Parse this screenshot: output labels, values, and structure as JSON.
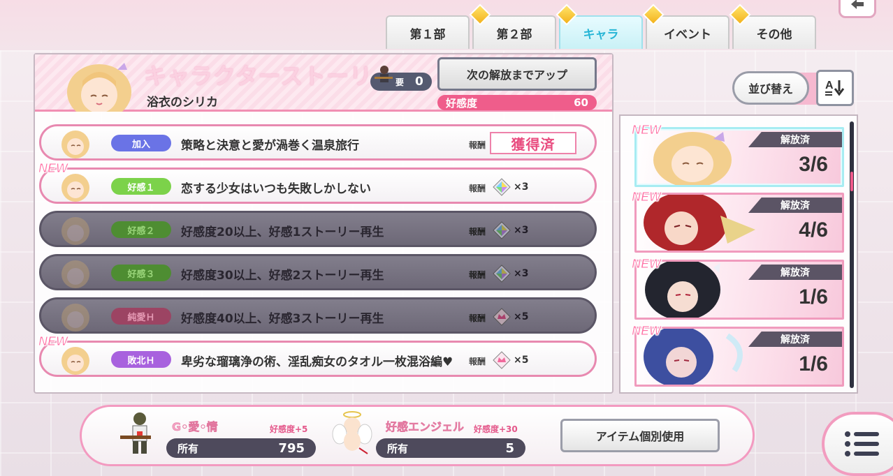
{
  "tabs": [
    {
      "label": "第１部",
      "badge": true
    },
    {
      "label": "第２部",
      "badge": true
    },
    {
      "label": "キャラ",
      "badge": true,
      "active": true
    },
    {
      "label": "イベント",
      "badge": true
    },
    {
      "label": "その他",
      "badge": true
    }
  ],
  "header": {
    "title": "キャラクターストーリー",
    "character_name": "浴衣のシリカ",
    "requirement_label": "要",
    "requirement_value": "0",
    "unlock_button": "次の解放までアップ",
    "affinity_label": "好感度",
    "affinity_value": "60"
  },
  "stories": [
    {
      "tag": "加入",
      "title": "策略と決意と愛が渦巻く温泉旅行",
      "reward_label": "報酬",
      "reward": "獲得済",
      "is_new": false,
      "locked": false
    },
    {
      "tag": "好感１",
      "title": "恋する少女はいつも失敗しかしない",
      "reward_label": "報酬",
      "reward": "×3",
      "is_new": true,
      "locked": false
    },
    {
      "tag": "好感２",
      "title": "好感度20以上、好感1ストーリー再生",
      "reward_label": "報酬",
      "reward": "×3",
      "is_new": false,
      "locked": true
    },
    {
      "tag": "好感３",
      "title": "好感度30以上、好感2ストーリー再生",
      "reward_label": "報酬",
      "reward": "×3",
      "is_new": false,
      "locked": true
    },
    {
      "tag": "純愛Ｈ",
      "title": "好感度40以上、好感3ストーリー再生",
      "reward_label": "報酬",
      "reward": "×5",
      "is_new": false,
      "locked": true
    },
    {
      "tag": "敗北Ｈ",
      "title": "卑劣な瑠璃浄の術、淫乱痴女のタオル一枚混浴編♥",
      "reward_label": "報酬",
      "reward": "×5",
      "is_new": true,
      "locked": false
    }
  ],
  "new_label": "NEW",
  "sort": {
    "label": "並び替え"
  },
  "characters": [
    {
      "status": "解放済",
      "count": "3/6",
      "is_new": true
    },
    {
      "status": "解放済",
      "count": "4/6",
      "is_new": true
    },
    {
      "status": "解放済",
      "count": "1/6",
      "is_new": true
    },
    {
      "status": "解放済",
      "count": "1/6",
      "is_new": true
    }
  ],
  "items": [
    {
      "name": "G◦愛◦情",
      "bonus": "好感度+5",
      "own_label": "所有",
      "own_value": "795"
    },
    {
      "name": "好感エンジェル",
      "bonus": "好感度+30",
      "own_label": "所有",
      "own_value": "5"
    }
  ],
  "use_button": "アイテム個別使用",
  "colors": {
    "accent_pink": "#ef5d8b",
    "active_tab": "#27b6d6",
    "locked_row": "#6d6877"
  }
}
